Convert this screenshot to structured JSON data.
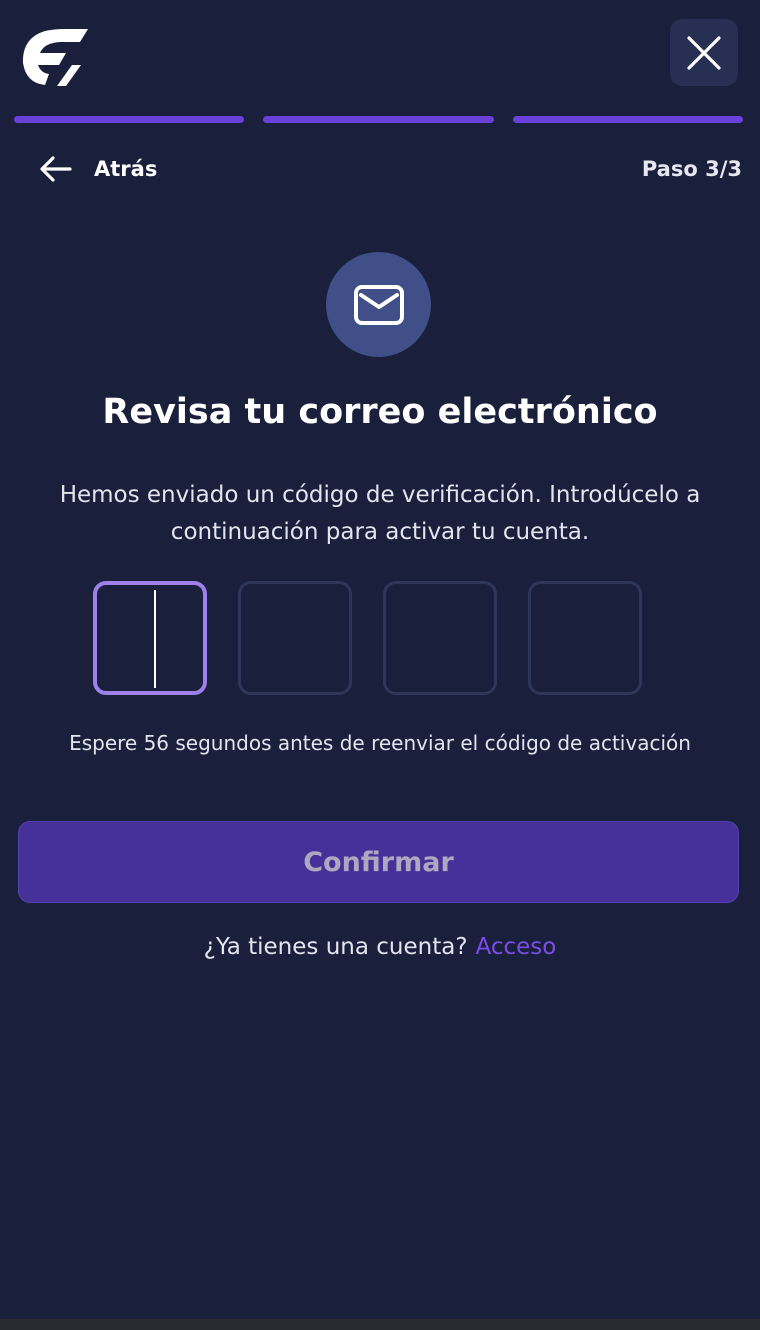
{
  "header": {
    "logo_icon": "brand-logo-icon",
    "close_icon": "close-icon"
  },
  "progress": {
    "total_steps": 3,
    "completed_steps": 3,
    "color": "#6a41d8"
  },
  "nav": {
    "back_label": "Atrás",
    "back_icon": "arrow-left-icon",
    "step_label": "Paso 3/3"
  },
  "main": {
    "mail_icon": "mail-icon",
    "title": "Revisa tu correo electrónico",
    "description": "Hemos enviado un código de verificación. Introdúcelo a continuación para activar tu cuenta.",
    "code_inputs": [
      "",
      "",
      "",
      ""
    ],
    "wait_message": "Espere 56 segundos antes de reenviar el código de activación",
    "confirm_label": "Confirmar",
    "login_prompt": "¿Ya tienes una cuenta?",
    "login_link": "Acceso"
  },
  "colors": {
    "background": "#1a1f3b",
    "accent": "#6a41d8",
    "active_border": "#9d80ea",
    "link": "#7a4ee6",
    "button": "#46309a"
  }
}
